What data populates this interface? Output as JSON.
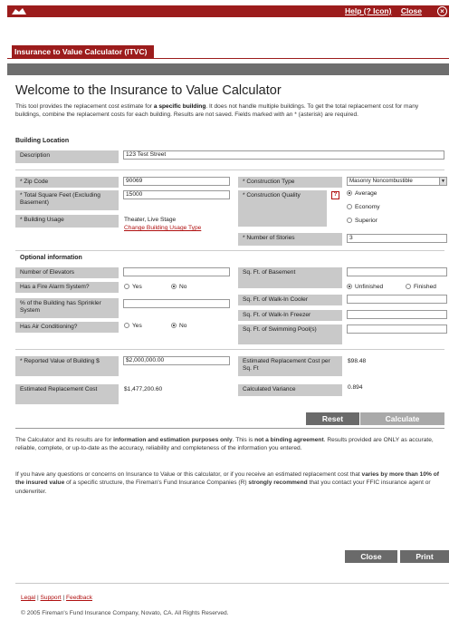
{
  "header": {
    "help_label": "Help (? Icon)",
    "close_label": "Close",
    "close_glyph": "×",
    "brand_color": "#9c1c1c"
  },
  "tab": {
    "label": "Insurance to Value Calculator (ITVC)"
  },
  "page": {
    "title": "Welcome to the Insurance to Value Calculator",
    "intro_a": "This tool provides the replacement cost estimate for ",
    "intro_b": "a specific building",
    "intro_c": ". It does not handle multiple buildings. To get the total replacement cost for many buildings, combine the replacement costs for each building. Results are not saved. Fields marked with an * (asterisk) are required."
  },
  "building_location": {
    "heading": "Building Location",
    "description_label": "Description",
    "description_value": "123 Test Street"
  },
  "main_form": {
    "zip_label": "* Zip Code",
    "zip_value": "90069",
    "sqft_label": "* Total Square Feet (Excluding Basement)",
    "sqft_value": "15000",
    "usage_label": "* Building Usage",
    "usage_value": "Theater, Live Stage",
    "usage_change_link": "Change Building Usage Type",
    "construction_type_label": "* Construction Type",
    "construction_type_value": "Masonry Noncombustible",
    "construction_quality_label": "* Construction Quality",
    "quality_help": "?",
    "quality_options": [
      "Average",
      "Economy",
      "Superior"
    ],
    "quality_selected": "Average",
    "stories_label": "* Number of Stories",
    "stories_value": "3"
  },
  "optional": {
    "heading": "Optional information",
    "elevators_label": "Number of Elevators",
    "fire_alarm_label": "Has a Fire Alarm System?",
    "sprinkler_label": "% of the Building has Sprinkler System",
    "ac_label": "Has Air Conditioning?",
    "yes": "Yes",
    "no": "No",
    "basement_label": "Sq. Ft. of Basement",
    "basement_unfinished": "Unfinished",
    "basement_finished": "Finished",
    "walkin_cooler_label": "Sq. Ft. of Walk-In Cooler",
    "walkin_freezer_label": "Sq. Ft. of Walk-In Freezer",
    "pool_label": "Sq. Ft. of Swimming Pool(s)"
  },
  "results": {
    "reported_label": "* Reported Value of Building $",
    "reported_value": "$2,000,000.00",
    "est_cost_label": "Estimated Replacement Cost",
    "est_cost_value": "$1,477,200.60",
    "per_sqft_label": "Estimated Replacement Cost per Sq. Ft",
    "per_sqft_value": "$98.48",
    "variance_label": "Calculated Variance",
    "variance_value": "0.894"
  },
  "actions": {
    "reset": "Reset",
    "calculate": "Calculate",
    "close": "Close",
    "print": "Print"
  },
  "disclaimer": {
    "p1_a": "The Calculator and its results are for ",
    "p1_b": "information and estimation purposes only",
    "p1_c": ". This is ",
    "p1_d": "not a binding agreement",
    "p1_e": ". Results provided are ONLY as accurate, reliable, complete, or up-to-date as the accuracy, reliability and completeness of the information you entered.",
    "p2_a": "If you have any questions or concerns on Insurance to Value or this calculator, or if you receive an estimated replacement cost that ",
    "p2_b": "varies by more than 10% of the insured value",
    "p2_c": " of a specific structure, the Fireman's Fund Insurance Companies (R) ",
    "p2_d": "strongly recommend",
    "p2_e": " that you contact your FFIC insurance agent or underwriter."
  },
  "footer": {
    "legal": "Legal",
    "support": "Support",
    "feedback": "Feedback",
    "sep": " | ",
    "copyright": "© 2005 Fireman's Fund Insurance Company, Novato, CA. All Rights Reserved."
  }
}
